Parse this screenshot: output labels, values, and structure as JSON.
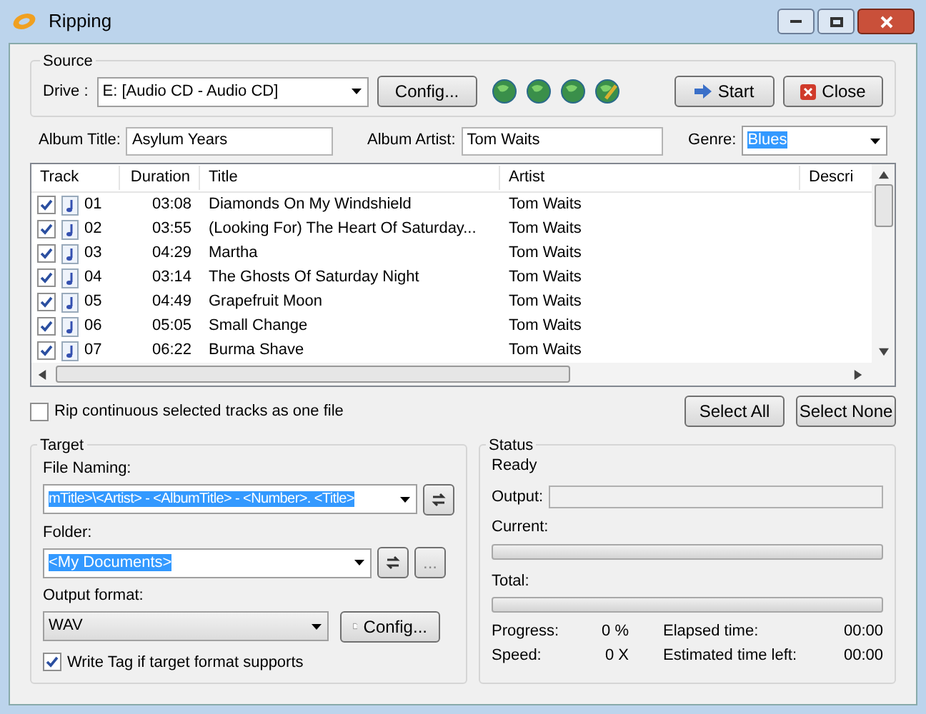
{
  "window": {
    "title": "Ripping"
  },
  "source": {
    "label": "Source",
    "drive_label": "Drive :",
    "drive": "E:  [Audio CD - Audio CD]",
    "config": "Config...",
    "start": "Start",
    "close": "Close"
  },
  "album": {
    "title_label": "Album Title:",
    "title": "Asylum Years",
    "artist_label": "Album Artist:",
    "artist": "Tom Waits",
    "genre_label": "Genre:",
    "genre": "Blues"
  },
  "table": {
    "columns": [
      "Track",
      "Duration",
      "Title",
      "Artist",
      "Descri"
    ],
    "rows": [
      {
        "checked": true,
        "track": "01",
        "duration": "03:08",
        "title": "Diamonds On My Windshield",
        "artist": "Tom Waits"
      },
      {
        "checked": true,
        "track": "02",
        "duration": "03:55",
        "title": "(Looking For) The Heart Of Saturday...",
        "artist": "Tom Waits"
      },
      {
        "checked": true,
        "track": "03",
        "duration": "04:29",
        "title": "Martha",
        "artist": "Tom Waits"
      },
      {
        "checked": true,
        "track": "04",
        "duration": "03:14",
        "title": "The Ghosts Of Saturday Night",
        "artist": "Tom Waits"
      },
      {
        "checked": true,
        "track": "05",
        "duration": "04:49",
        "title": "Grapefruit Moon",
        "artist": "Tom Waits"
      },
      {
        "checked": true,
        "track": "06",
        "duration": "05:05",
        "title": "Small Change",
        "artist": "Tom Waits"
      },
      {
        "checked": true,
        "track": "07",
        "duration": "06:22",
        "title": "Burma Shave",
        "artist": "Tom Waits"
      }
    ]
  },
  "rip_continuous": {
    "label": "Rip continuous selected tracks as one file",
    "checked": false
  },
  "select_all": "Select All",
  "select_none": "Select None",
  "target": {
    "label": "Target",
    "naming_label": "File Naming:",
    "naming": "mTitle>\\<Artist> - <AlbumTitle> - <Number>. <Title>",
    "folder_label": "Folder:",
    "folder": "<My Documents>",
    "browse": "...",
    "format_label": "Output format:",
    "format": "WAV",
    "config": "Config...",
    "write_tag": {
      "label": "Write Tag if target format supports",
      "checked": true
    }
  },
  "status": {
    "label": "Status",
    "state": "Ready",
    "output_label": "Output:",
    "current_label": "Current:",
    "current": {
      "level": 0
    },
    "total_label": "Total:",
    "total": {
      "level": 0
    },
    "stats": [
      {
        "label": "Progress:",
        "value": "0 %"
      },
      {
        "label": "Elapsed time:",
        "value": "00:00"
      },
      {
        "label": "Speed:",
        "value": "0 X"
      },
      {
        "label": "Estimated time left:",
        "value": "00:00"
      }
    ]
  }
}
